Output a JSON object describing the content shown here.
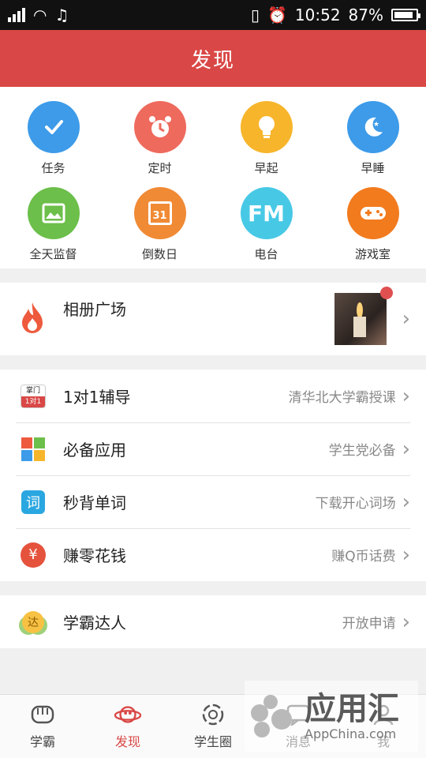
{
  "status_bar": {
    "time": "10:52",
    "battery": "87%",
    "battery_level": 0.87
  },
  "header": {
    "title": "发现"
  },
  "grid": [
    {
      "label": "任务",
      "icon": "check-icon",
      "color": "#3d9be9"
    },
    {
      "label": "定时",
      "icon": "alarm-clock-icon",
      "color": "#ee6a5d"
    },
    {
      "label": "早起",
      "icon": "lightbulb-icon",
      "color": "#f7b52c"
    },
    {
      "label": "早睡",
      "icon": "moon-icon",
      "color": "#3d9be9"
    },
    {
      "label": "全天监督",
      "icon": "image-icon",
      "color": "#6cbf4a"
    },
    {
      "label": "倒数日",
      "icon": "calendar-icon",
      "color": "#f08a35",
      "icon_text": "31"
    },
    {
      "label": "电台",
      "icon": "fm-icon",
      "color": "#47c9e6",
      "icon_text": "FM"
    },
    {
      "label": "游戏室",
      "icon": "gamepad-icon",
      "color": "#f27b1e"
    }
  ],
  "album": {
    "title": "相册广场"
  },
  "list1": [
    {
      "label": "1对1辅导",
      "sub": "清华北大学霸授课",
      "icon": "zhangmen-icon",
      "icon_top": "掌门",
      "icon_bottom": "1对1"
    },
    {
      "label": "必备应用",
      "sub": "学生党必备",
      "icon": "apps-grid-icon"
    },
    {
      "label": "秒背单词",
      "sub": "下载开心词场",
      "icon": "words-icon",
      "icon_text": "词"
    },
    {
      "label": "赚零花钱",
      "sub": "赚Q币话费",
      "icon": "yuan-icon",
      "icon_text": "¥"
    }
  ],
  "list2": [
    {
      "label": "学霸达人",
      "sub": "开放申请",
      "icon": "badge-icon",
      "icon_text": "达"
    }
  ],
  "tabs": [
    {
      "label": "学霸",
      "icon": "fist-icon",
      "active": false
    },
    {
      "label": "发现",
      "icon": "planet-icon",
      "active": true
    },
    {
      "label": "学生圈",
      "icon": "circle-icon",
      "active": false
    },
    {
      "label": "消息",
      "icon": "message-icon",
      "active": false
    },
    {
      "label": "我",
      "icon": "person-icon",
      "active": false
    }
  ],
  "watermark": {
    "title": "应用汇",
    "url": "AppChina.com"
  },
  "colors": {
    "brand": "#d94846",
    "badge": "#e05050"
  }
}
